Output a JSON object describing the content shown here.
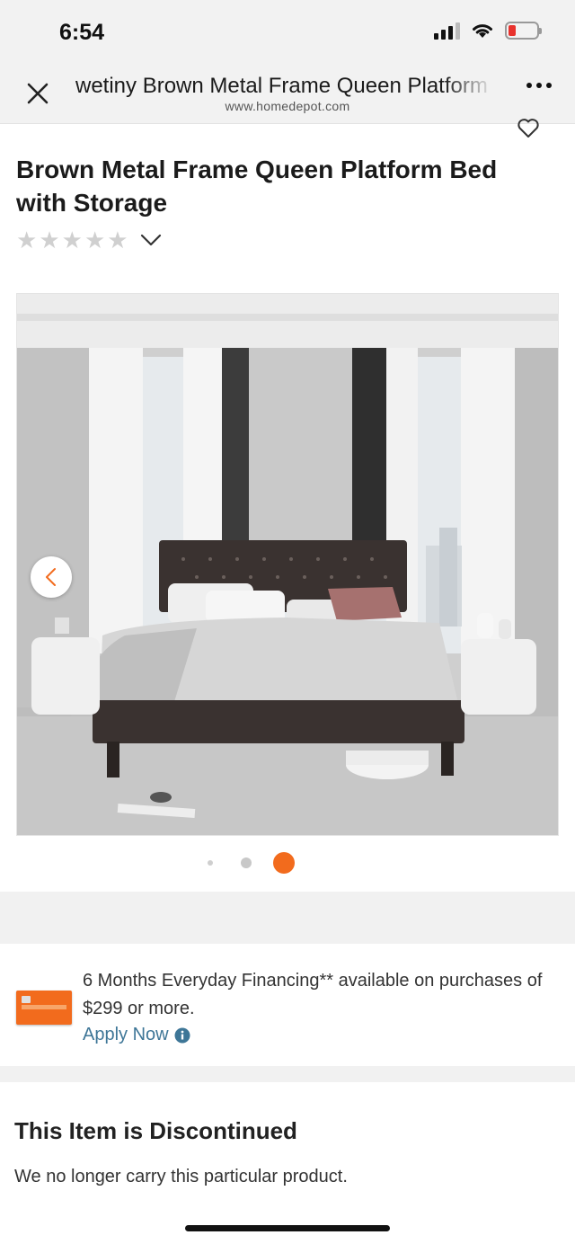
{
  "status_bar": {
    "time": "6:54"
  },
  "browser": {
    "page_title": "wetiny Brown Metal Frame Queen Platform Bed with Storage",
    "url": "www.homedepot.com"
  },
  "product": {
    "title": "Brown Metal Frame Queen Platform Bed with Storage",
    "rating_stars": 5,
    "rating_filled": 0,
    "image_index": 3,
    "image_count": 3
  },
  "financing": {
    "text": "6 Months Everyday Financing** available on purchases of $299 or more.",
    "apply_label": "Apply Now"
  },
  "discontinued": {
    "title": "This Item is Discontinued",
    "text": "We no longer carry this particular product."
  },
  "colors": {
    "accent": "#f26b1d",
    "link": "#3e7697",
    "battery_low": "#e8322d"
  },
  "icons": [
    "close-icon",
    "more-icon",
    "heart-icon",
    "star-icon",
    "chevron-down-icon",
    "chevron-left-icon",
    "info-icon",
    "wifi-icon",
    "signal-icon",
    "battery-icon"
  ]
}
